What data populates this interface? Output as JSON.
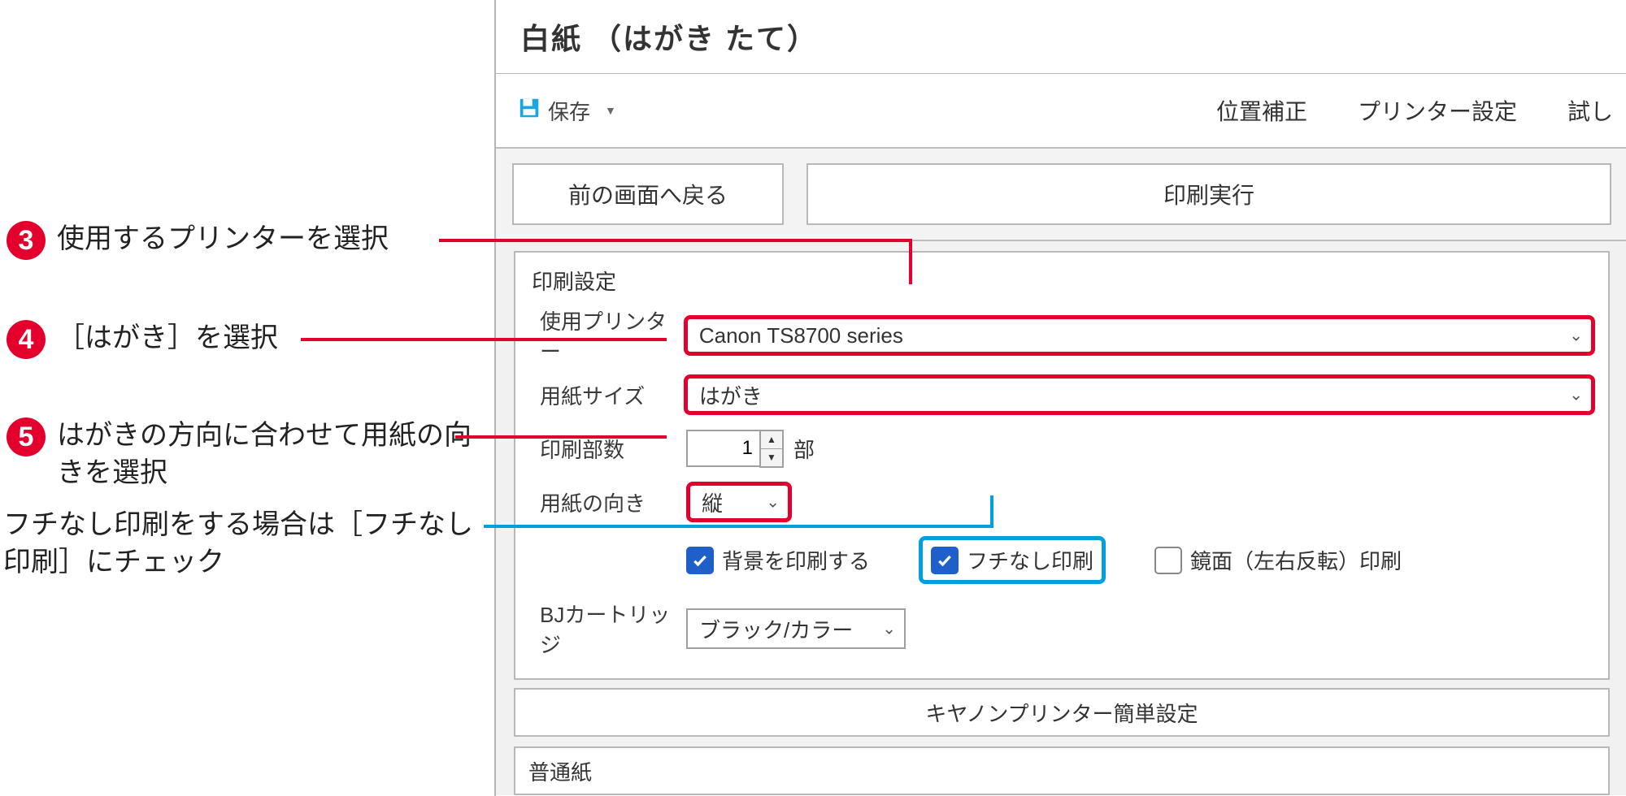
{
  "title": "白紙 （はがき たて）",
  "toolbar": {
    "save": "保存",
    "pos_correct": "位置補正",
    "printer_settings": "プリンター設定",
    "test_print_partial": "試し"
  },
  "buttons": {
    "back": "前の画面へ戻る",
    "execute": "印刷実行"
  },
  "settings": {
    "heading": "印刷設定",
    "printer": {
      "label": "使用プリンター",
      "value": "Canon TS8700 series"
    },
    "paper_size": {
      "label": "用紙サイズ",
      "value": "はがき"
    },
    "copies": {
      "label": "印刷部数",
      "value": "1",
      "unit": "部"
    },
    "orientation": {
      "label": "用紙の向き",
      "value": "縦"
    },
    "checkboxes": {
      "background": "背景を印刷する",
      "borderless": "フチなし印刷",
      "mirror": "鏡面（左右反転）印刷"
    },
    "cartridge": {
      "label": "BJカートリッジ",
      "value": "ブラック/カラー"
    },
    "easy_title": "キヤノンプリンター簡単設定",
    "paper_type": "普通紙"
  },
  "annotations": {
    "a3": "使用するプリンターを選択",
    "a4": "［はがき］を選択",
    "a5": "はがきの方向に合わせて用紙の向きを選択",
    "a_border": "フチなし印刷をする場合は［フチなし印刷］にチェック"
  }
}
